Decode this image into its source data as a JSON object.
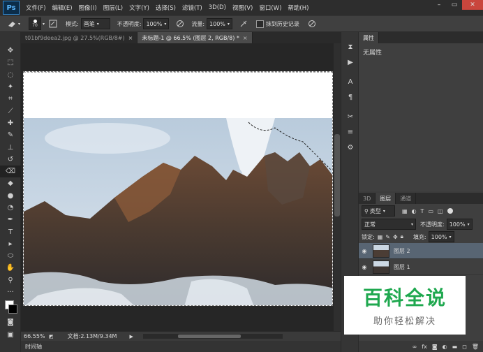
{
  "app": {
    "logo": "Ps"
  },
  "menu": [
    "文件(F)",
    "编辑(E)",
    "图像(I)",
    "图层(L)",
    "文字(Y)",
    "选择(S)",
    "滤镜(T)",
    "3D(D)",
    "视图(V)",
    "窗口(W)",
    "帮助(H)"
  ],
  "options": {
    "brush_size": "70",
    "mode_label": "模式:",
    "mode_value": "画笔",
    "opacity_label": "不透明度:",
    "opacity_value": "100%",
    "flow_label": "流量:",
    "flow_value": "100%",
    "history_label": "抹到历史记录"
  },
  "tabs": [
    {
      "label": "t01bf9deea2.jpg @ 27.5%(RGB/8#)",
      "close": "×"
    },
    {
      "label": "未标题-1 @ 66.5% (图层 2, RGB/8) *",
      "close": "×"
    }
  ],
  "status": {
    "zoom": "66.55%",
    "doc": "文档:2.13M/9.34M"
  },
  "timeline_label": "时间轴",
  "properties": {
    "tab": "属性",
    "content": "无属性"
  },
  "layers_panel": {
    "tabs": [
      "3D",
      "图层",
      "通道"
    ],
    "filter_label": "类型",
    "blend_mode": "正常",
    "opacity_label": "不透明度:",
    "opacity_value": "100%",
    "lock_label": "锁定:",
    "fill_label": "填充:",
    "fill_value": "100%",
    "layers": [
      {
        "name": "图层 2",
        "selected": true
      },
      {
        "name": "图层 1",
        "selected": false
      }
    ]
  },
  "watermark": {
    "title": "百科全说",
    "subtitle": "助你轻松解决"
  },
  "colors": {
    "accent": "#2e8ad6",
    "selection": "#586573",
    "watermark_green": "#1fa84f"
  }
}
